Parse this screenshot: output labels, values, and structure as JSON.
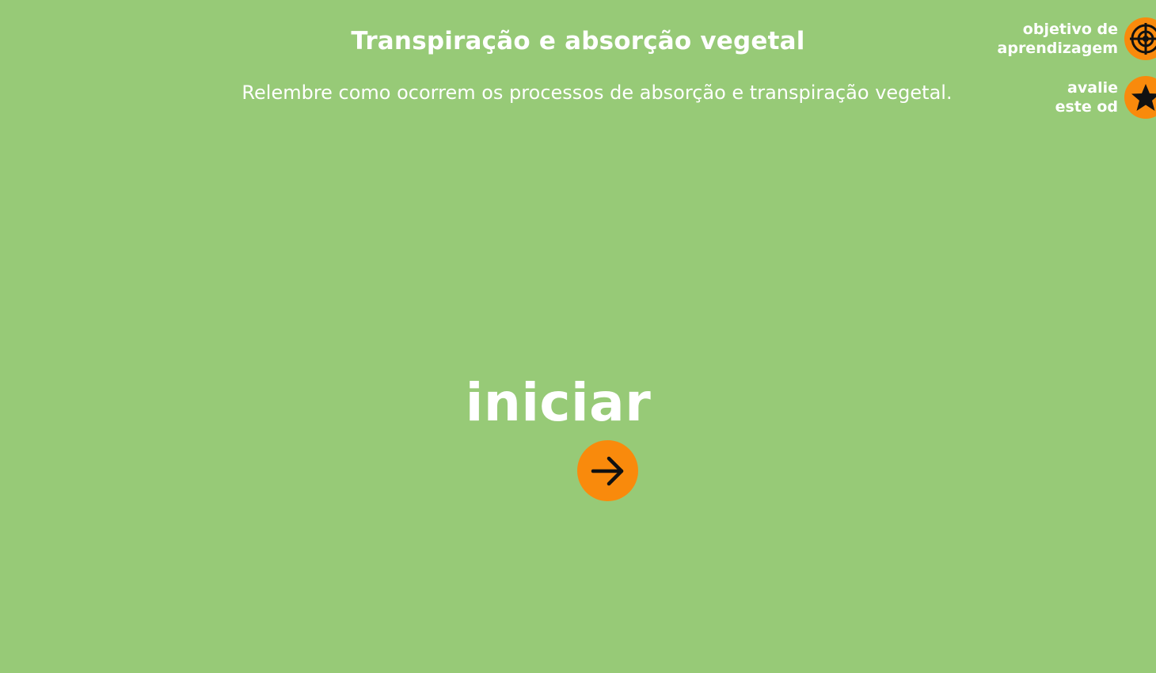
{
  "header": {
    "title": "Transpiração e absorção vegetal",
    "subtitle": "Relembre como ocorrem os processos de absorção e transpiração vegetal."
  },
  "side_menu": {
    "objective": {
      "label": "objetivo de\naprendizagem",
      "icon": "target-icon"
    },
    "rate": {
      "label": "avalie\neste od",
      "icon": "star-icon"
    }
  },
  "start": {
    "label": "iniciar",
    "icon": "arrow-right-icon"
  },
  "colors": {
    "background": "#97ca77",
    "accent": "#f98a0c",
    "text": "#ffffff",
    "icon": "#111111"
  }
}
